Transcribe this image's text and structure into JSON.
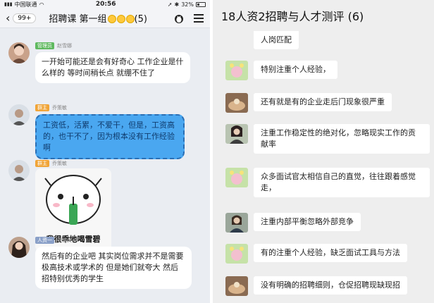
{
  "left": {
    "status": {
      "carrier": "中国联通",
      "time": "20:56",
      "battery": "32%"
    },
    "nav": {
      "back_count": "99+",
      "title": "招聘课 第一组",
      "count": "(5)"
    },
    "messages": [
      {
        "role": "管理员",
        "name": "赵雪娜",
        "text": "一开始可能还是会有好奇心 工作企业是什么样的 等时间稍长点 就绷不住了"
      },
      {
        "role": "群主",
        "name": "乔策敏",
        "text": "工资低，活累，不爱干，但是，工资高的，也干不了，因为根本没有工作经验啊"
      },
      {
        "role": "群主",
        "name": "乔策敏",
        "sticker_caption": "我很乖地喝雪碧"
      },
      {
        "role": "人资一",
        "name": "李爱英",
        "text": "然后有的企业吧 其实岗位需求并不是需要极高技术或学术的 但是她们就夸大 然后招特别优秀的学生"
      }
    ]
  },
  "right": {
    "title": "18人资2招聘与人才测评 (6)",
    "messages": [
      {
        "text": "人岗匹配"
      },
      {
        "text": "特别注重个人经验，"
      },
      {
        "text": "还有就是有的企业走后门现象很严重"
      },
      {
        "text": "注重工作稳定性的绝对化，忽略现实工作的贡献率"
      },
      {
        "text": "众多面试官太相信自己的直觉，往往跟着感觉走，"
      },
      {
        "text": "注重内部平衡忽略外部竞争"
      },
      {
        "text": "有的注重个人经验，缺乏面试工具与方法"
      },
      {
        "text": "没有明确的招聘细则，仓促招聘现缺现招"
      }
    ]
  }
}
